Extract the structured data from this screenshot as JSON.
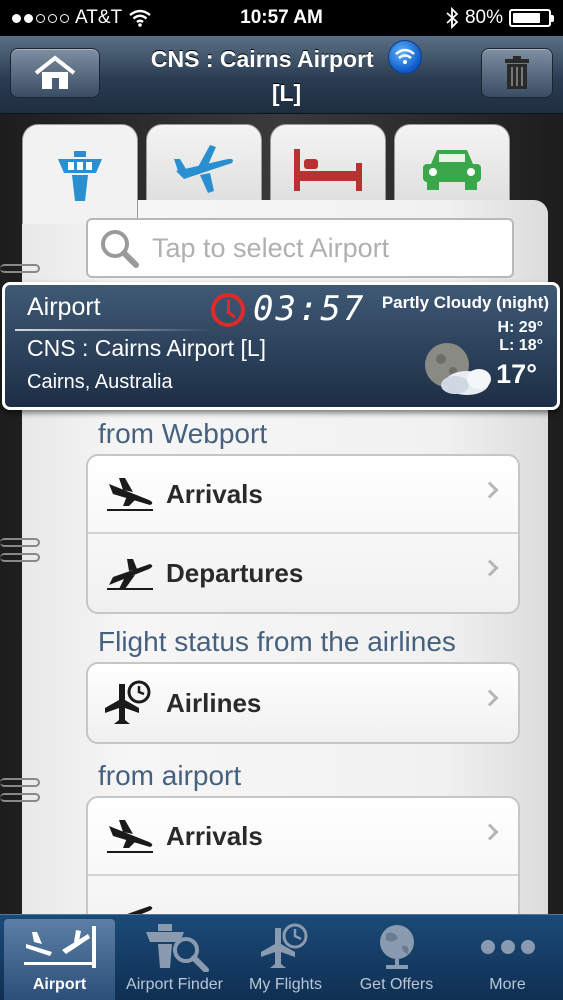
{
  "status_bar": {
    "carrier": "AT&T",
    "time": "10:57 AM",
    "battery": "80%",
    "battery_level": 0.8
  },
  "nav": {
    "title_line1": "CNS : Cairns Airport",
    "title_line2": "[L]"
  },
  "tabs": [
    {
      "icon": "control-tower-icon",
      "color": "#2a8fd0"
    },
    {
      "icon": "airplane-icon",
      "color": "#2a8fd0"
    },
    {
      "icon": "bed-icon",
      "color": "#b83232"
    },
    {
      "icon": "car-icon",
      "color": "#3aa84a"
    }
  ],
  "search": {
    "placeholder": "Tap to select Airport"
  },
  "airport_card": {
    "heading": "Airport",
    "time": "03:57",
    "airport": "CNS : Cairns Airport [L]",
    "city": "Cairns, Australia",
    "weather": "Partly Cloudy (night)",
    "high": "H: 29°",
    "low": "L: 18°",
    "temp": "17°"
  },
  "sections": {
    "webport_title": "from Webport",
    "webport_arrivals": "Arrivals",
    "webport_departures": "Departures",
    "airlines_title": "Flight status from the airlines",
    "airlines": "Airlines",
    "airport_title": "from airport",
    "airport_arrivals": "Arrivals"
  },
  "tabbar": {
    "airport": "Airport",
    "airport_finder": "Airport Finder",
    "my_flights": "My Flights",
    "get_offers": "Get Offers",
    "more": "More"
  }
}
